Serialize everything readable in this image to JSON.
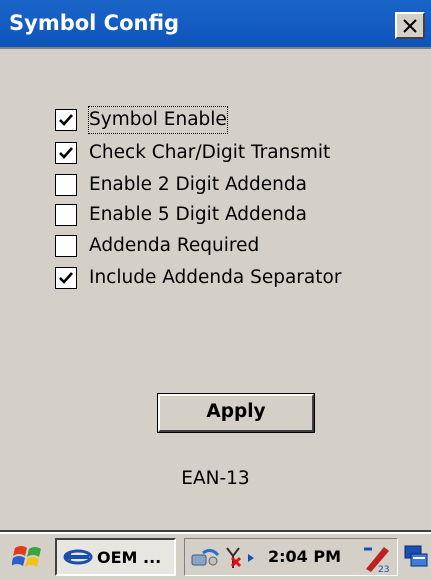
{
  "window": {
    "title": "Symbol Config",
    "close_glyph": "×"
  },
  "options": [
    {
      "label": "Symbol Enable",
      "checked": true,
      "focused": true
    },
    {
      "label": "Check Char/Digit Transmit",
      "checked": true,
      "focused": false
    },
    {
      "label": "Enable 2 Digit Addenda",
      "checked": false,
      "focused": false
    },
    {
      "label": "Enable 5 Digit Addenda",
      "checked": false,
      "focused": false
    },
    {
      "label": "Addenda Required",
      "checked": false,
      "focused": false
    },
    {
      "label": "Include Addenda Separator",
      "checked": true,
      "focused": false
    }
  ],
  "apply_label": "Apply",
  "symbol_name": "EAN-13",
  "taskbar": {
    "task_label": "OEM ...",
    "clock": "2:04 PM",
    "icons": [
      "windows-flag-icon",
      "oem-app-icon",
      "network-icon",
      "antenna-disconnected-icon",
      "input-panel-icon",
      "desktop-icon"
    ]
  },
  "colors": {
    "title_bar": "#0e55bb",
    "surface": "#d4d0c8"
  }
}
